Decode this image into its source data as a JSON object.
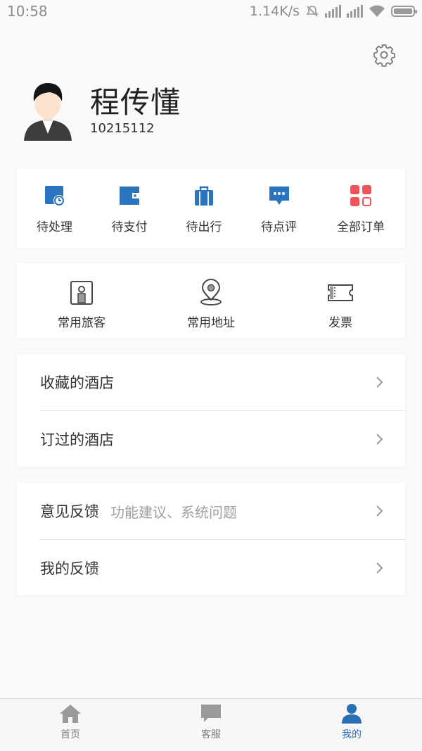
{
  "status_bar": {
    "time": "10:58",
    "net_speed": "1.14K/s",
    "icons": [
      "mute-icon",
      "signal-hd-icon",
      "signal-hd-icon",
      "wifi-icon",
      "battery-icon"
    ]
  },
  "header": {
    "settings_icon": "gear-icon"
  },
  "profile": {
    "name": "程传懂",
    "id": "10215112",
    "avatar_icon": "user-avatar-icon"
  },
  "orders": {
    "items": [
      {
        "label": "待处理",
        "icon": "clock-doc-icon"
      },
      {
        "label": "待支付",
        "icon": "wallet-icon"
      },
      {
        "label": "待出行",
        "icon": "luggage-icon"
      },
      {
        "label": "待点评",
        "icon": "comment-icon"
      },
      {
        "label": "全部订单",
        "icon": "grid-icon"
      }
    ],
    "colors": {
      "blue": "#2a74c0",
      "red": "#f2545b"
    }
  },
  "utilities": {
    "items": [
      {
        "label": "常用旅客",
        "icon": "id-card-icon"
      },
      {
        "label": "常用地址",
        "icon": "location-pin-icon"
      },
      {
        "label": "发票",
        "icon": "ticket-icon"
      }
    ]
  },
  "hotels": {
    "rows": [
      {
        "label": "收藏的酒店"
      },
      {
        "label": "订过的酒店"
      }
    ]
  },
  "feedback": {
    "rows": [
      {
        "label": "意见反馈",
        "hint": "功能建议、系统问题"
      },
      {
        "label": "我的反馈"
      }
    ]
  },
  "bottom_nav": {
    "items": [
      {
        "label": "首页",
        "icon": "home-icon"
      },
      {
        "label": "客服",
        "icon": "chat-icon"
      },
      {
        "label": "我的",
        "icon": "person-icon",
        "active": true
      }
    ],
    "active_color": "#2a6fb5",
    "inactive_color": "#9a9a9a"
  }
}
